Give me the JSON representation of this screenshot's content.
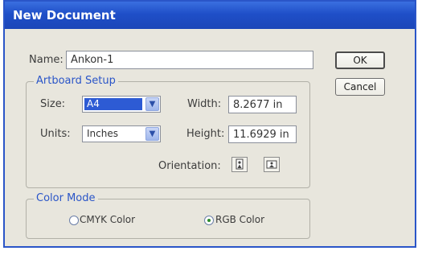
{
  "dialog": {
    "title": "New Document",
    "name_label": "Name:",
    "name_value": "Ankon-1",
    "ok_label": "OK",
    "cancel_label": "Cancel"
  },
  "artboard": {
    "title": "Artboard Setup",
    "size_label": "Size:",
    "size_value": "A4",
    "units_label": "Units:",
    "units_value": "Inches",
    "width_label": "Width:",
    "width_value": "8.2677 in",
    "height_label": "Height:",
    "height_value": "11.6929 in",
    "orientation_label": "Orientation:",
    "orientation_selected": "portrait"
  },
  "color_mode": {
    "title": "Color Mode",
    "options": [
      {
        "label": "CMYK Color",
        "selected": false
      },
      {
        "label": "RGB Color",
        "selected": true
      }
    ]
  },
  "colors": {
    "title_bar": "#1f4fc8",
    "group_title": "#2a55c8",
    "dialog_bg": "#e8e6dd",
    "selection": "#2d5bd4"
  }
}
